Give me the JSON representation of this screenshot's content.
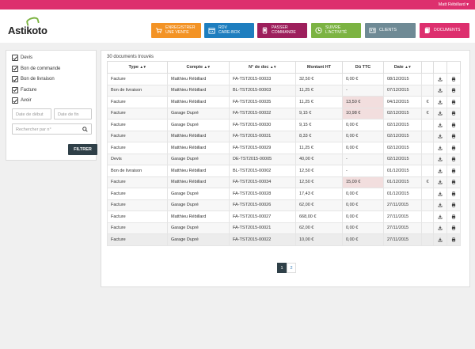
{
  "topbar": {
    "user": "Matt Rébillard ▾"
  },
  "logo": {
    "text": "Astikoto"
  },
  "nav": [
    {
      "line1": "ENREGISTRER",
      "line2": "UNE VENTE",
      "color": "#f39325",
      "icon": "cart-icon"
    },
    {
      "line1": "RDV",
      "line2": "CARE-BOX",
      "color": "#1e7ebf",
      "icon": "calendar-icon"
    },
    {
      "line1": "PASSER",
      "line2": "COMMANDE",
      "color": "#9d1f5c",
      "icon": "phone-icon"
    },
    {
      "line1": "SUIVRE",
      "line2": "L'ACTIVITÉ",
      "color": "#7cb342",
      "icon": "clock-icon"
    },
    {
      "line1": "CLIENTS",
      "line2": "",
      "color": "#6f8a95",
      "icon": "users-icon"
    },
    {
      "line1": "DOCUMENTS",
      "line2": "",
      "color": "#dd2f6e",
      "icon": "documents-icon"
    }
  ],
  "filters": {
    "checkboxes": [
      "Devis",
      "Bon de commande",
      "Bon de livraison",
      "Facture",
      "Avoir"
    ],
    "date_start_placeholder": "Date de début",
    "date_end_placeholder": "Date de fin",
    "search_placeholder": "Rechercher par n°",
    "submit": "FILTRER"
  },
  "documents": {
    "count_label": "30 documents trouvés",
    "columns": [
      "Type",
      "Compte",
      "N° de doc",
      "Montant HT",
      "Dû TTC",
      "Date"
    ],
    "rows": [
      {
        "type": "Facture",
        "compte": "Matthieu Rébillard",
        "num": "FA-TST2015-00033",
        "ht": "32,50 €",
        "due": "0,00 €",
        "date": "08/12/2015",
        "euro": "",
        "due_red": false
      },
      {
        "type": "Bon de livraison",
        "compte": "Matthieu Rébillard",
        "num": "BL-TST2015-00003",
        "ht": "11,25 €",
        "due": "-",
        "date": "07/12/2015",
        "euro": "",
        "due_red": false
      },
      {
        "type": "Facture",
        "compte": "Matthieu Rébillard",
        "num": "FA-TST2015-00035",
        "ht": "11,25 €",
        "due": "13,50 €",
        "date": "04/12/2015",
        "euro": "€",
        "due_red": true
      },
      {
        "type": "Facture",
        "compte": "Garage Dupré",
        "num": "FA-TST2015-00032",
        "ht": "9,15 €",
        "due": "10,98 €",
        "date": "02/12/2015",
        "euro": "€",
        "due_red": true
      },
      {
        "type": "Facture",
        "compte": "Garage Dupré",
        "num": "FA-TST2015-00030",
        "ht": "9,15 €",
        "due": "0,00 €",
        "date": "02/12/2015",
        "euro": "",
        "due_red": false
      },
      {
        "type": "Facture",
        "compte": "Matthieu Rébillard",
        "num": "FA-TST2015-00031",
        "ht": "8,33 €",
        "due": "0,00 €",
        "date": "02/12/2015",
        "euro": "",
        "due_red": false
      },
      {
        "type": "Facture",
        "compte": "Matthieu Rébillard",
        "num": "FA-TST2015-00029",
        "ht": "11,25 €",
        "due": "0,00 €",
        "date": "02/12/2015",
        "euro": "",
        "due_red": false
      },
      {
        "type": "Devis",
        "compte": "Garage Dupré",
        "num": "DE-TST2015-00005",
        "ht": "40,00 €",
        "due": "-",
        "date": "02/12/2015",
        "euro": "",
        "due_red": false
      },
      {
        "type": "Bon de livraison",
        "compte": "Matthieu Rébillard",
        "num": "BL-TST2015-00002",
        "ht": "12,50 €",
        "due": "-",
        "date": "01/12/2015",
        "euro": "",
        "due_red": false
      },
      {
        "type": "Facture",
        "compte": "Matthieu Rébillard",
        "num": "FA-TST2015-00034",
        "ht": "12,50 €",
        "due": "15,00 €",
        "date": "01/12/2015",
        "euro": "€",
        "due_red": true
      },
      {
        "type": "Facture",
        "compte": "Garage Dupré",
        "num": "FA-TST2015-00028",
        "ht": "17,43 €",
        "due": "0,00 €",
        "date": "01/12/2015",
        "euro": "",
        "due_red": false
      },
      {
        "type": "Facture",
        "compte": "Garage Dupré",
        "num": "FA-TST2015-00026",
        "ht": "62,00 €",
        "due": "0,00 €",
        "date": "27/11/2015",
        "euro": "",
        "due_red": false
      },
      {
        "type": "Facture",
        "compte": "Matthieu Rébillard",
        "num": "FA-TST2015-00027",
        "ht": "668,00 €",
        "due": "0,00 €",
        "date": "27/11/2015",
        "euro": "",
        "due_red": false
      },
      {
        "type": "Facture",
        "compte": "Garage Dupré",
        "num": "FA-TST2015-00021",
        "ht": "62,00 €",
        "due": "0,00 €",
        "date": "27/11/2015",
        "euro": "",
        "due_red": false
      },
      {
        "type": "Facture",
        "compte": "Garage Dupré",
        "num": "FA-TST2015-00022",
        "ht": "10,00 €",
        "due": "0,00 €",
        "date": "27/11/2015",
        "euro": "",
        "due_red": false
      }
    ]
  },
  "pagination": {
    "pages": [
      "1",
      "2"
    ],
    "active": 0
  },
  "sort_glyph": "▲▼"
}
